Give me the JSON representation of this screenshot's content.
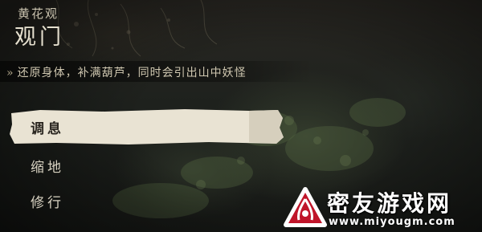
{
  "location": {
    "region": "黄花观",
    "shrine": "观门"
  },
  "description": {
    "marker": "»",
    "text": "还原身体，补满葫芦，同时会引出山中妖怪"
  },
  "menu": {
    "items": [
      {
        "label": "调息",
        "selected": true
      },
      {
        "label": "缩地",
        "selected": false
      },
      {
        "label": "修行",
        "selected": false
      }
    ]
  },
  "watermark": {
    "brand": "密友游戏网",
    "url": "www.miyougm.com",
    "color": "#c0152a"
  }
}
